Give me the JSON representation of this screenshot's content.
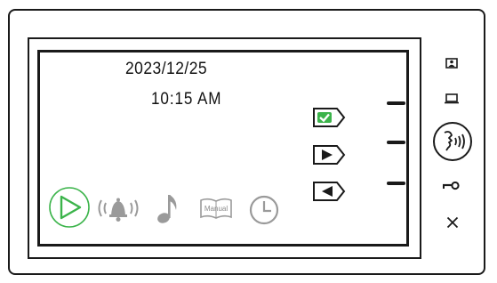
{
  "screen": {
    "date": "2023/12/25",
    "time": "10:15 AM"
  },
  "menu": {
    "items": [
      {
        "icon": "play-icon",
        "selected": true
      },
      {
        "icon": "bell-ringing-icon"
      },
      {
        "icon": "music-note-icon"
      },
      {
        "icon": "manual-book-icon",
        "label": "Manual"
      },
      {
        "icon": "clock-icon"
      }
    ]
  },
  "soft_keys": [
    {
      "icon": "check-icon"
    },
    {
      "icon": "right-arrow-icon"
    },
    {
      "icon": "left-arrow-icon"
    }
  ],
  "side_panel": [
    {
      "icon": "camera-monitor-icon"
    },
    {
      "icon": "monitor-icon"
    },
    {
      "icon": "talk-icon"
    },
    {
      "icon": "key-icon"
    },
    {
      "icon": "close-icon"
    }
  ],
  "colors": {
    "accent_green": "#3cb44b",
    "outline": "#1a1a1a",
    "icon_gray": "#9a9a9a"
  }
}
